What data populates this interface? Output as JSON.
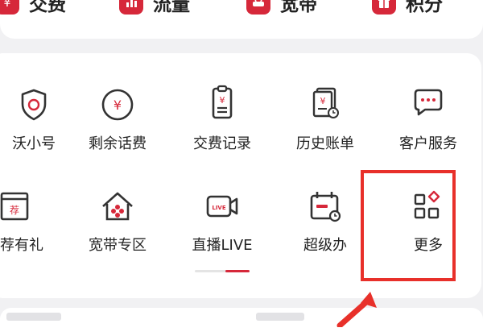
{
  "top_row": {
    "items": [
      {
        "label": "交费",
        "icon": "yuan-icon"
      },
      {
        "label": "流量",
        "icon": "bar-chart-icon"
      },
      {
        "label": "宽带",
        "icon": "router-icon"
      },
      {
        "label": "积分",
        "icon": "gift-icon"
      }
    ]
  },
  "grid": {
    "row1": [
      {
        "label": "沃小号",
        "icon": "shield-phone-icon"
      },
      {
        "label": "剩余话费",
        "icon": "yuan-circle-icon"
      },
      {
        "label": "交费记录",
        "icon": "receipt-icon"
      },
      {
        "label": "历史账单",
        "icon": "bill-history-icon"
      },
      {
        "label": "客户服务",
        "icon": "chat-bubble-icon"
      }
    ],
    "row2": [
      {
        "label": "推荐有礼",
        "icon_text": "荐",
        "icon": "recommend-icon"
      },
      {
        "label": "宽带专区",
        "icon": "home-network-icon"
      },
      {
        "label": "直播LIVE",
        "icon_text": "LIVE",
        "icon": "live-camera-icon"
      },
      {
        "label": "超级办",
        "icon": "calendar-clock-icon"
      },
      {
        "label": "更多",
        "icon": "more-grid-icon"
      }
    ]
  },
  "pager": {
    "pages": 2,
    "active": 2
  },
  "colors": {
    "accent": "#d6283a",
    "highlight": "#e8302a",
    "icon_stroke": "#333333"
  }
}
